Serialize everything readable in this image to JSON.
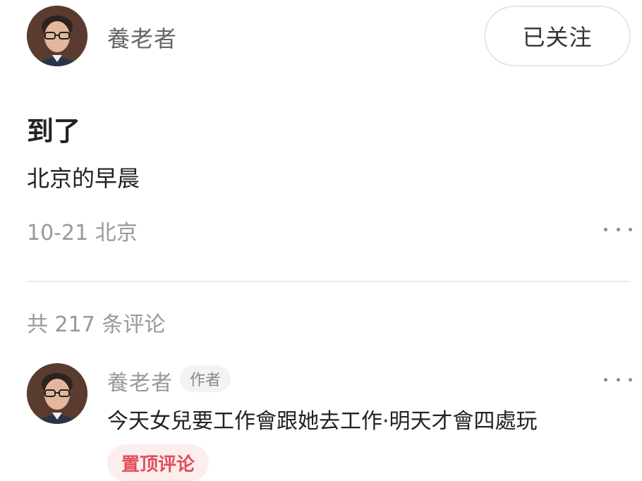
{
  "post": {
    "author": {
      "name": "養老者",
      "avatar_icon": "user-avatar"
    },
    "follow_label": "已关注",
    "title": "到了",
    "body": "北京的早晨",
    "date": "10-21",
    "location": "北京",
    "more_icon": "more-dots-icon"
  },
  "comments": {
    "summary": "共 217 条评论",
    "items": [
      {
        "author": "養老者",
        "author_badge": "作者",
        "text": "今天女兒要工作會跟她去工作·明天才會四處玩",
        "pinned_badge": "置顶评论",
        "more_icon": "more-dots-icon"
      }
    ]
  },
  "colors": {
    "pinned_text": "#e04e5a",
    "pinned_bg": "#fdeeee",
    "muted_text": "#999999"
  }
}
